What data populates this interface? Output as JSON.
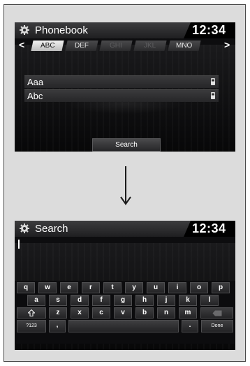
{
  "phonebook_screen": {
    "title": "Phonebook",
    "clock": "12:34",
    "tabs": [
      {
        "label": "ABC",
        "state": "active"
      },
      {
        "label": "DEF",
        "state": "normal"
      },
      {
        "label": "GHI",
        "state": "disabled"
      },
      {
        "label": "JKL",
        "state": "disabled"
      },
      {
        "label": "MNO",
        "state": "normal"
      }
    ],
    "entries": [
      {
        "name": "Aaa"
      },
      {
        "name": "Abc"
      }
    ],
    "search_button": "Search"
  },
  "transition_arrow": "down-arrow-icon",
  "search_screen": {
    "title": "Search",
    "clock": "12:34",
    "keyboard": {
      "row1": [
        "q",
        "w",
        "e",
        "r",
        "t",
        "y",
        "u",
        "i",
        "o",
        "p"
      ],
      "row2": [
        "a",
        "s",
        "d",
        "f",
        "g",
        "h",
        "j",
        "k",
        "l"
      ],
      "row3": [
        "z",
        "x",
        "c",
        "v",
        "b",
        "n",
        "m"
      ],
      "shift_icon": "shift-icon",
      "backspace_icon": "backspace-icon",
      "symbols_label": "?123",
      "comma": ",",
      "period": ".",
      "done_label": "Done"
    }
  },
  "colors": {
    "screen_bg": "#0d0d0f",
    "panel_bg": "#dcdcdc",
    "active_tab": "#e0e0e0"
  }
}
